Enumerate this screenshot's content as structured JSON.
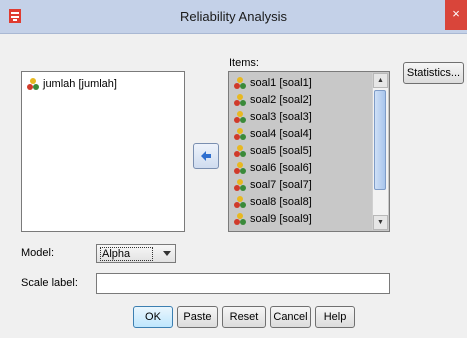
{
  "window": {
    "title": "Reliability Analysis",
    "close_glyph": "×"
  },
  "source_list": {
    "items": [
      {
        "label": "jumlah [jumlah]",
        "icon": "scale-variable-icon"
      }
    ]
  },
  "items_list": {
    "label": "Items:",
    "items": [
      {
        "label": "soal1 [soal1]"
      },
      {
        "label": "soal2 [soal2]"
      },
      {
        "label": "soal3 [soal3]"
      },
      {
        "label": "soal4 [soal4]"
      },
      {
        "label": "soal5 [soal5]"
      },
      {
        "label": "soal6 [soal6]"
      },
      {
        "label": "soal7 [soal7]"
      },
      {
        "label": "soal8 [soal8]"
      },
      {
        "label": "soal9 [soal9]"
      }
    ],
    "selected_bg": "#c8c8c8"
  },
  "buttons": {
    "statistics": "Statistics...",
    "ok": "OK",
    "paste": "Paste",
    "reset": "Reset",
    "cancel": "Cancel",
    "help": "Help"
  },
  "model": {
    "label": "Model:",
    "value": "Alpha"
  },
  "scale_label": {
    "label": "Scale label:",
    "value": ""
  },
  "colors": {
    "titlebar": "#c4d1e8",
    "close": "#d9453a",
    "arrow": "#2f6fcf"
  }
}
